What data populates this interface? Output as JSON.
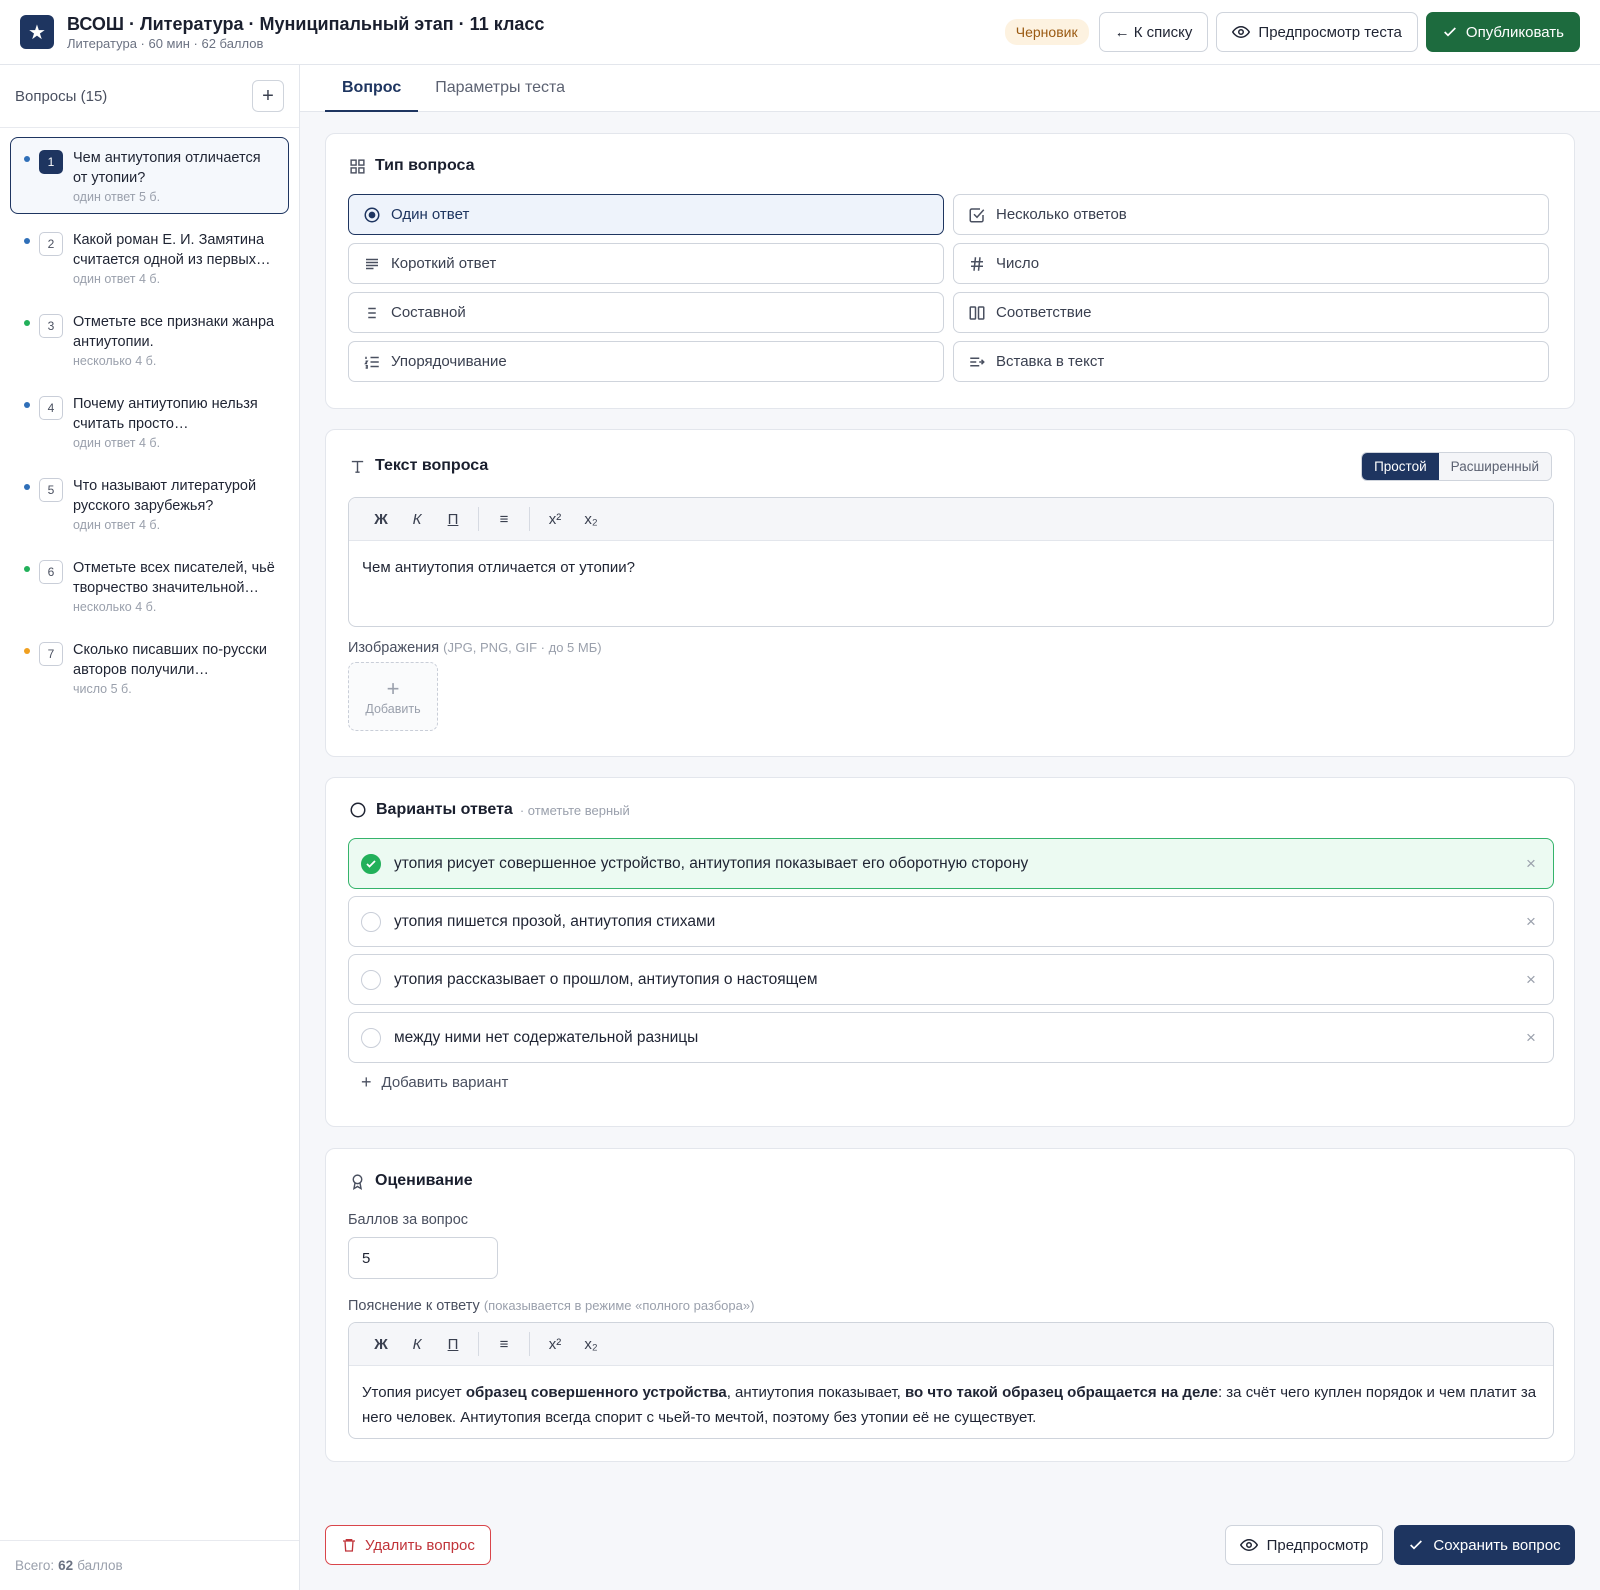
{
  "header": {
    "logo_glyph": "★",
    "title": "ВСОШ · Литература · Муниципальный этап · 11 класс",
    "subtitle": "Литература · 60 мин · 62 баллов",
    "status_badge": "Черновик",
    "back_label": "← К списку",
    "preview_label": "Предпросмотр теста",
    "publish_label": "Опубликовать"
  },
  "sidebar": {
    "title": "Вопросы (15)",
    "add_glyph": "+",
    "items": [
      {
        "num": "1",
        "text": "Чем антиутопия отличается от утопии?",
        "type": "один ответ",
        "points": "5 б.",
        "dot": "#2f6fb8"
      },
      {
        "num": "2",
        "text": "Какой роман Е. И. Замятина считается одной из первых…",
        "type": "один ответ",
        "points": "4 б.",
        "dot": "#2f6fb8"
      },
      {
        "num": "3",
        "text": "Отметьте все признаки жанра антиутопии.",
        "type": "несколько",
        "points": "4 б.",
        "dot": "#22b05a"
      },
      {
        "num": "4",
        "text": "Почему антиутопию нельзя считать просто…",
        "type": "один ответ",
        "points": "4 б.",
        "dot": "#2f6fb8"
      },
      {
        "num": "5",
        "text": "Что называют литературой русского зарубежья?",
        "type": "один ответ",
        "points": "4 б.",
        "dot": "#2f6fb8"
      },
      {
        "num": "6",
        "text": "Отметьте всех писателей, чьё творчество значительной…",
        "type": "несколько",
        "points": "4 б.",
        "dot": "#22b05a"
      },
      {
        "num": "7",
        "text": "Сколько писавших по-русски авторов получили…",
        "type": "число",
        "points": "5 б.",
        "dot": "#f0a020"
      }
    ],
    "footer_prefix": "Всего:",
    "footer_value": "62",
    "footer_suffix": "баллов"
  },
  "tabs": [
    {
      "label": "Вопрос",
      "active": true
    },
    {
      "label": "Параметры теста",
      "active": false
    }
  ],
  "question_type": {
    "title": "Тип вопроса",
    "options": [
      {
        "label": "Один ответ",
        "icon": "radio-icon"
      },
      {
        "label": "Несколько ответов",
        "icon": "checkbox-icon"
      },
      {
        "label": "Короткий ответ",
        "icon": "short-text-icon"
      },
      {
        "label": "Число",
        "icon": "hash-icon"
      },
      {
        "label": "Составной",
        "icon": "list-icon"
      },
      {
        "label": "Соответствие",
        "icon": "columns-icon"
      },
      {
        "label": "Упорядочивание",
        "icon": "ordered-list-icon"
      },
      {
        "label": "Вставка в текст",
        "icon": "insert-text-icon"
      }
    ],
    "selected": "Один ответ"
  },
  "question_text": {
    "title": "Текст вопроса",
    "mode_simple": "Простой",
    "mode_advanced": "Расширенный",
    "toolbar": {
      "bold": "Ж",
      "italic": "К",
      "underline": "П",
      "list": "≡",
      "sup": "x²",
      "sub": "x₂"
    },
    "value": "Чем антиутопия отличается от утопии?",
    "images_label": "Изображения",
    "images_hint": "(JPG, PNG, GIF · до 5 МБ)",
    "add_image_label": "Добавить"
  },
  "answers": {
    "title": "Варианты ответа",
    "hint": "· отметьте верный",
    "options": [
      {
        "text": "утопия рисует совершенное устройство, антиутопия показывает его оборотную сторону",
        "correct": true
      },
      {
        "text": "утопия пишется прозой, антиутопия стихами",
        "correct": false
      },
      {
        "text": "утопия рассказывает о прошлом, антиутопия о настоящем",
        "correct": false
      },
      {
        "text": "между ними нет содержательной разницы",
        "correct": false
      }
    ],
    "remove_glyph": "×",
    "add_label": "Добавить вариант"
  },
  "grading": {
    "title": "Оценивание",
    "points_label": "Баллов за вопрос",
    "points_value": "5",
    "explanation_label": "Пояснение к ответу",
    "explanation_hint": "(показывается в режиме «полного разбора»)",
    "explanation_parts": {
      "p1": "Утопия рисует ",
      "b1": "образец совершенного устройства",
      "p2": ", антиутопия показывает, ",
      "b2": "во что такой образец обращается на деле",
      "p3": ": за счёт чего куплен порядок и чем платит за него человек. Антиутопия всегда спорит с чьей-то мечтой, поэтому без утопии её не существует."
    }
  },
  "footer": {
    "delete_label": "Удалить вопрос",
    "preview_label": "Предпросмотр",
    "save_label": "Сохранить вопрос"
  },
  "colors": {
    "brand": "#1e3560",
    "publish": "#1d6b3e",
    "correct": "#22b05a",
    "danger": "#c0343a"
  }
}
